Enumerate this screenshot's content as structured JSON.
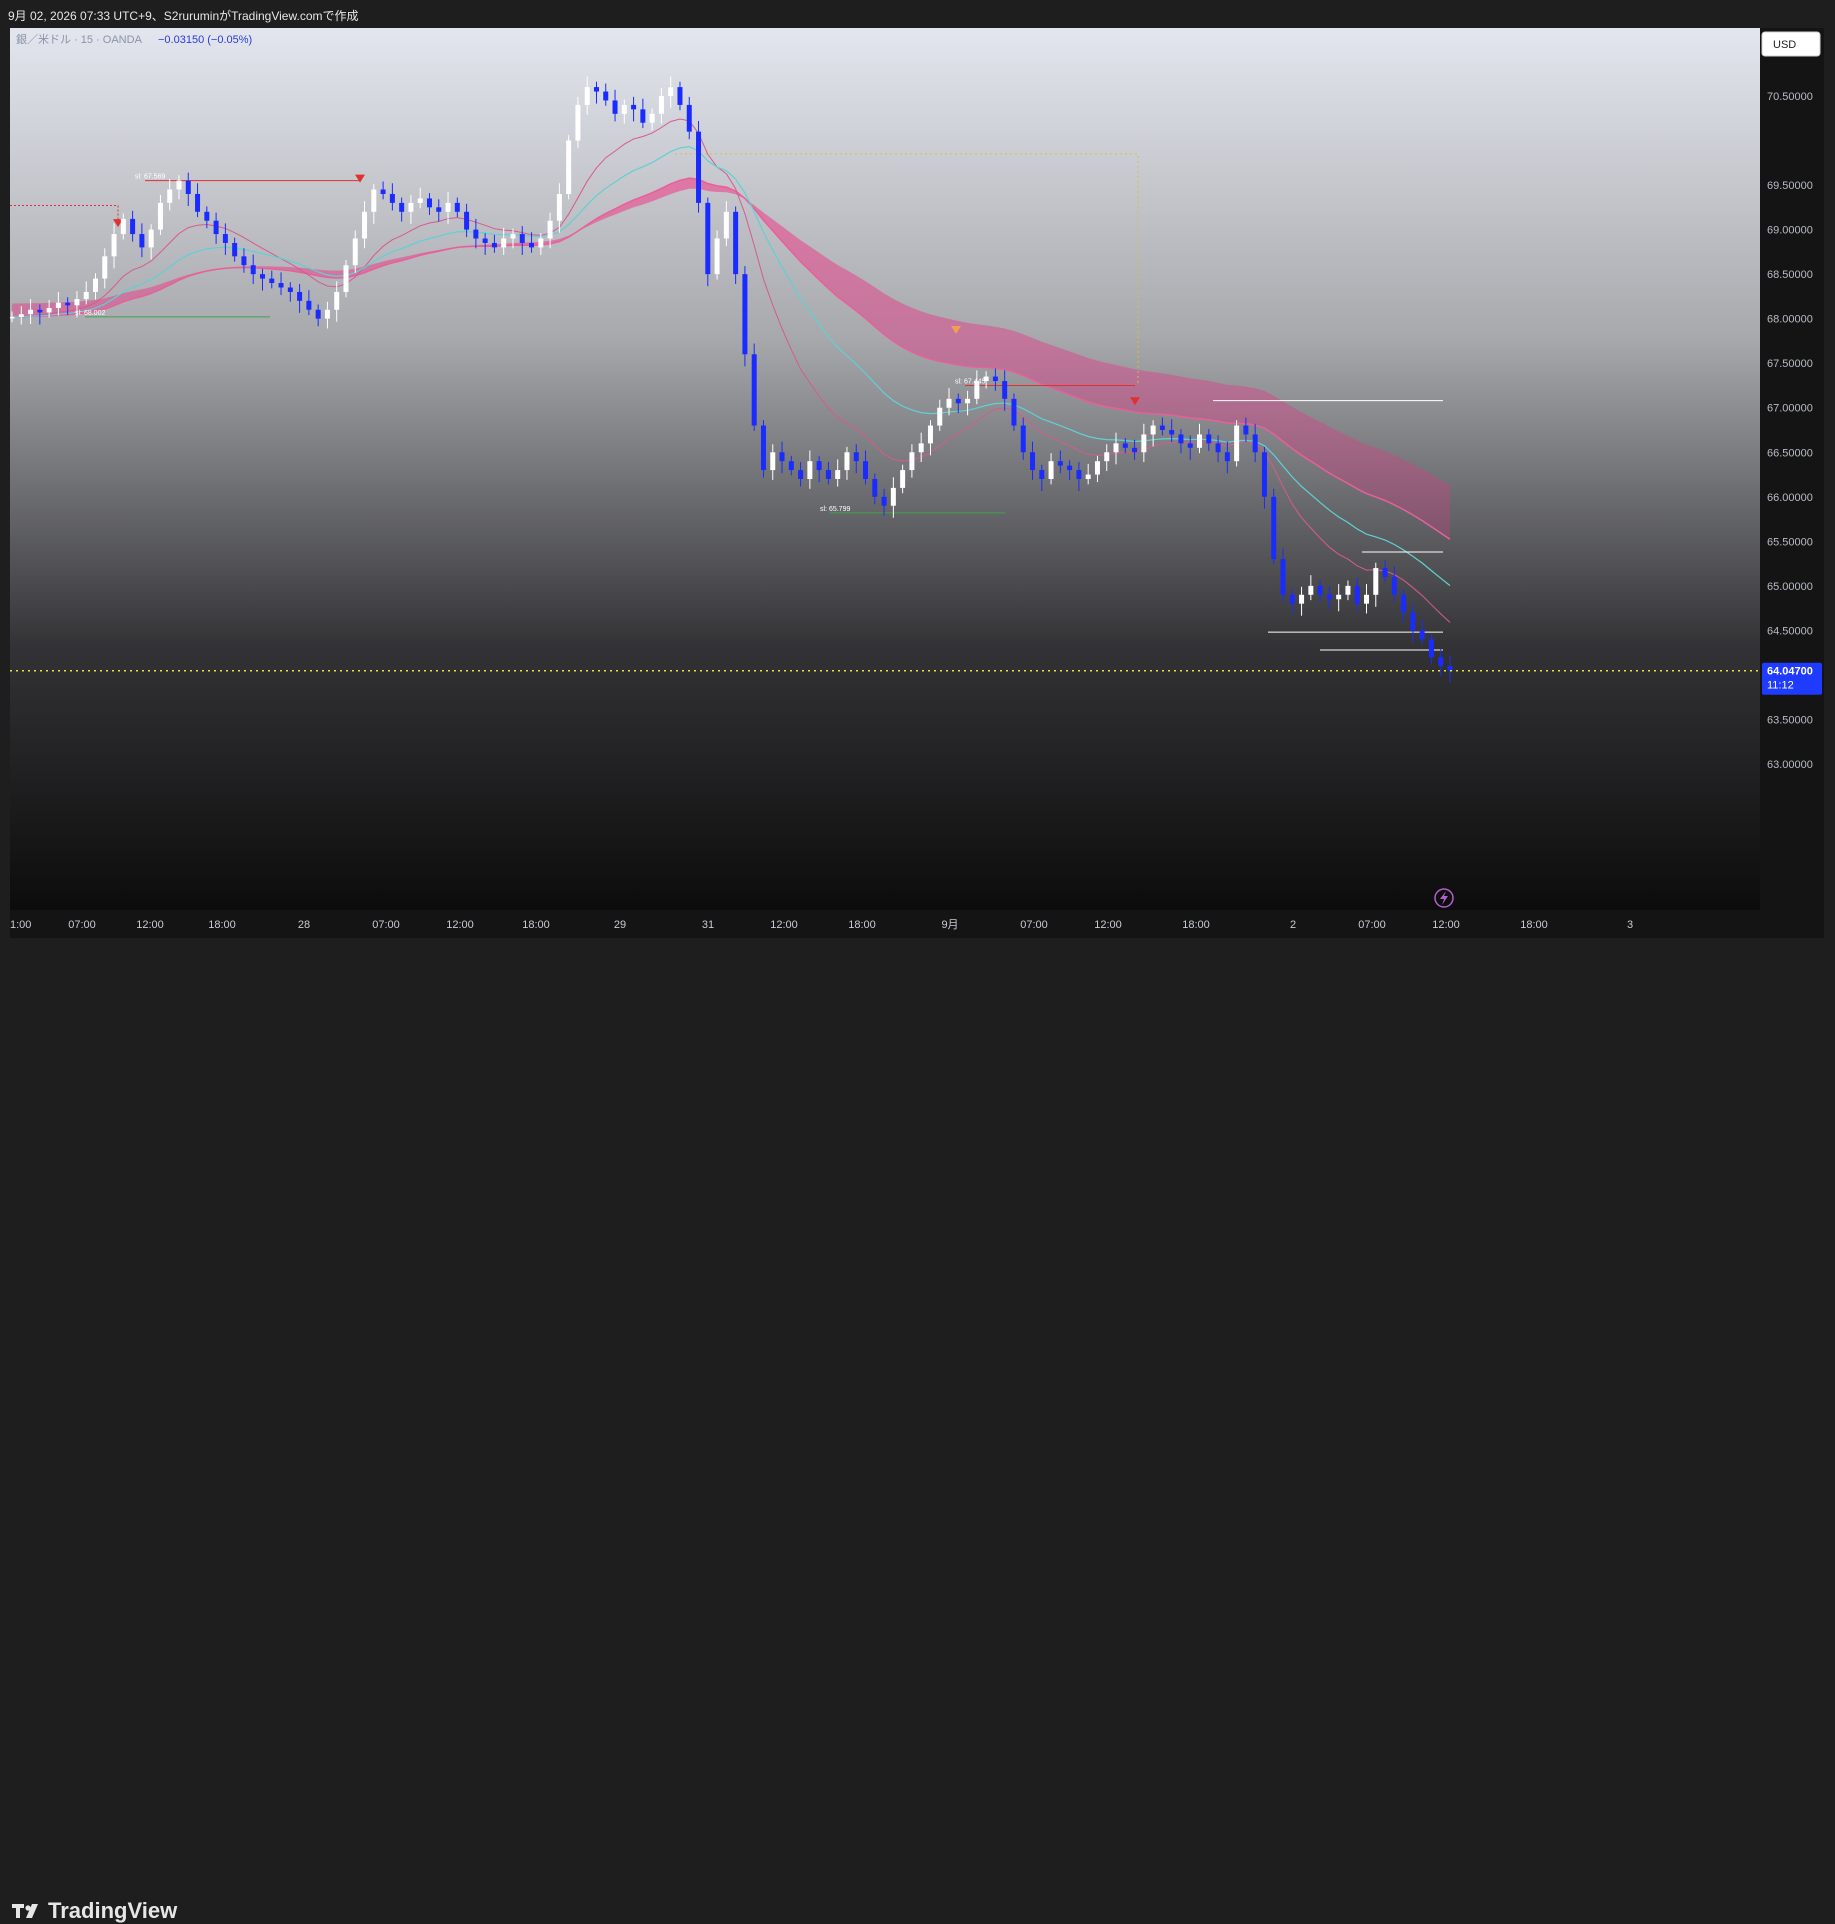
{
  "header": {
    "caption": "9月 02, 2026 07:33 UTC+9、S2rurumin​がTradingView.comで作成"
  },
  "legend": {
    "symbol": "銀／米ドル · 15 · OANDA",
    "change": "−0.03150 (−0.05%)"
  },
  "currency_button": {
    "label": "USD"
  },
  "price_badge": {
    "price": "64.04700",
    "countdown": "11:12"
  },
  "footer": {
    "brand": "TradingView"
  },
  "colors": {
    "up": "#ffffff",
    "down": "#1a2bff",
    "ribbon": "#e8609a",
    "cyan": "#5fd0d6",
    "current_line": "#f0e040"
  },
  "chart_data": {
    "type": "line",
    "title": "銀／米ドル · 15 · OANDA",
    "ylabel": "USD",
    "ylim": [
      62.8,
      71.0
    ],
    "x_tick_labels": [
      "1:00",
      "07:00",
      "12:00",
      "18:00",
      "28",
      "07:00",
      "12:00",
      "18:00",
      "29",
      "31",
      "12:00",
      "18:00",
      "9月",
      "07:00",
      "12:00",
      "18:00",
      "2",
      "07:00",
      "12:00",
      "18:00",
      "3"
    ],
    "y_tick_labels": [
      "70.50000",
      "69.50000",
      "69.00000",
      "68.50000",
      "68.00000",
      "67.50000",
      "67.00000",
      "66.50000",
      "66.00000",
      "65.50000",
      "65.00000",
      "64.50000",
      "63.50000",
      "63.00000"
    ],
    "last_price": 64.047,
    "series": [
      {
        "values": [
          68.02,
          68.05,
          68.1,
          68.07,
          68.12,
          68.18,
          68.15,
          68.22,
          68.3,
          68.45,
          68.7,
          68.95,
          69.12,
          68.95,
          68.8,
          69.0,
          69.3,
          69.45,
          69.55,
          69.4,
          69.2,
          69.1,
          68.95,
          68.85,
          68.7,
          68.6,
          68.5,
          68.45,
          68.4,
          68.35,
          68.3,
          68.2,
          68.1,
          68.0,
          68.1,
          68.3,
          68.6,
          68.9,
          69.2,
          69.45,
          69.4,
          69.3,
          69.2,
          69.3,
          69.35,
          69.25,
          69.2,
          69.3,
          69.2,
          69.0,
          68.9,
          68.85,
          68.8,
          68.9,
          68.95,
          68.85,
          68.8,
          68.9,
          69.1,
          69.4,
          70.0,
          70.4,
          70.6,
          70.55,
          70.45,
          70.3,
          70.4,
          70.35,
          70.2,
          70.3,
          70.5,
          70.6,
          70.4,
          70.1,
          69.3,
          68.5,
          68.9,
          69.2,
          68.5,
          67.6,
          66.8,
          66.3,
          66.5,
          66.4,
          66.3,
          66.2,
          66.4,
          66.3,
          66.2,
          66.3,
          66.5,
          66.4,
          66.2,
          66.0,
          65.9,
          66.1,
          66.3,
          66.5,
          66.6,
          66.8,
          67.0,
          67.1,
          67.05,
          67.1,
          67.3,
          67.35,
          67.3,
          67.1,
          66.8,
          66.5,
          66.3,
          66.2,
          66.4,
          66.35,
          66.3,
          66.2,
          66.25,
          66.4,
          66.5,
          66.6,
          66.55,
          66.5,
          66.7,
          66.8,
          66.75,
          66.7,
          66.6,
          66.55,
          66.7,
          66.6,
          66.5,
          66.4,
          66.8,
          66.7,
          66.5,
          66.0,
          65.3,
          64.9,
          64.8,
          64.9,
          65.0,
          64.9,
          64.85,
          64.9,
          65.0,
          64.8,
          64.9,
          65.2,
          65.1,
          64.9,
          64.7,
          64.5,
          64.4,
          64.2,
          64.1,
          64.05
        ]
      }
    ],
    "annotations": [
      "sl: 67.569",
      "sl: 68.002",
      "sl: 67.445",
      "sl: 65.799"
    ]
  }
}
